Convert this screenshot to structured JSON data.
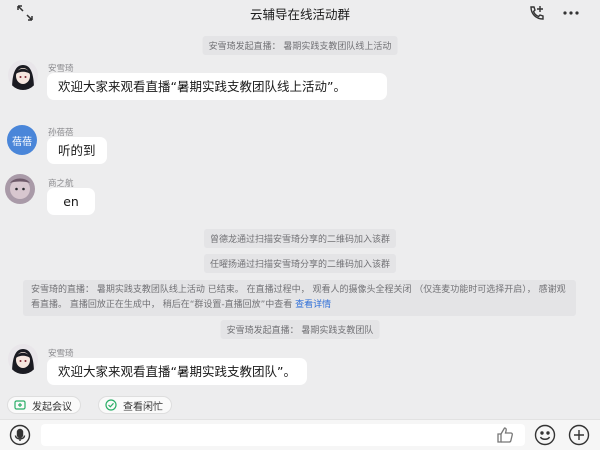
{
  "header": {
    "title": "云辅导在线活动群"
  },
  "messages": {
    "sys1": "安雪琦发起直播： 暑期实践支教团队线上活动",
    "m1": {
      "sender": "安雪琦",
      "text": "欢迎大家来观看直播“暑期实践支教团队线上活动”。"
    },
    "m2": {
      "sender": "孙蓓蓓",
      "avatar_text": "蓓蓓",
      "text": "听的到"
    },
    "m3": {
      "sender": "商之航",
      "text": "en"
    },
    "sys2": "曾德龙通过扫描安雪琦分享的二维码加入该群",
    "sys3": "任曜扬通过扫描安雪琦分享的二维码加入该群",
    "sys4": {
      "text": "安雪琦的直播： 暑期实践支教团队线上活动 已结束。 在直播过程中， 观看人的摄像头全程关闭 （仅连麦功能时可选择开启）， 感谢观看直播。 直播回放正在生成中， 稍后在“群设置-直播回放”中查看",
      "link": "查看详情"
    },
    "sys5": "安雪琦发起直播： 暑期实践支教团队",
    "m4": {
      "sender": "安雪琦",
      "text": "欢迎大家来观看直播“暑期实践支教团队”。"
    }
  },
  "quick_actions": {
    "meeting": "发起会议",
    "schedule": "查看闲忙"
  },
  "input": {
    "value": ""
  },
  "icons": {
    "expand": "expand-arrows-icon",
    "call": "phone-add-icon",
    "more": "more-dots-icon",
    "voice": "voice-icon",
    "thumb": "thumbs-up-icon",
    "emoji": "emoji-icon",
    "plus": "plus-icon"
  },
  "colors": {
    "background": "#ededee",
    "bubble": "#ffffff",
    "link": "#2f6fd8",
    "avatar_blue": "#4a86d9",
    "schedule_green": "#2aae67"
  }
}
